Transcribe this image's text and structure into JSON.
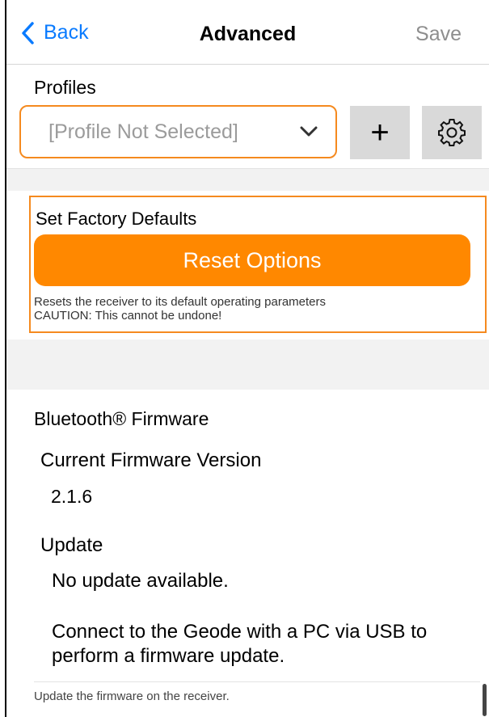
{
  "nav": {
    "back_label": "Back",
    "title": "Advanced",
    "save_label": "Save"
  },
  "profiles": {
    "label": "Profiles",
    "placeholder": "[Profile Not Selected]",
    "add_label": "+"
  },
  "factory": {
    "title": "Set Factory Defaults",
    "button_label": "Reset Options",
    "note_line1": "Resets the receiver to its default operating parameters",
    "note_line2": "CAUTION: This cannot be undone!"
  },
  "firmware": {
    "section_title": "Bluetooth® Firmware",
    "current_label": "Current Firmware Version",
    "current_value": "2.1.6",
    "update_label": "Update",
    "update_status": "No update available.",
    "update_instructions": "Connect to the Geode with a PC via USB to perform a firmware update.",
    "footer_note": "Update the firmware on the receiver."
  },
  "colors": {
    "accent": "#ff8800",
    "link": "#0a7bff",
    "border": "#f58a1f"
  },
  "icons": {
    "back": "chevron-left-icon",
    "dropdown": "chevron-down-icon",
    "settings": "gear-icon"
  }
}
